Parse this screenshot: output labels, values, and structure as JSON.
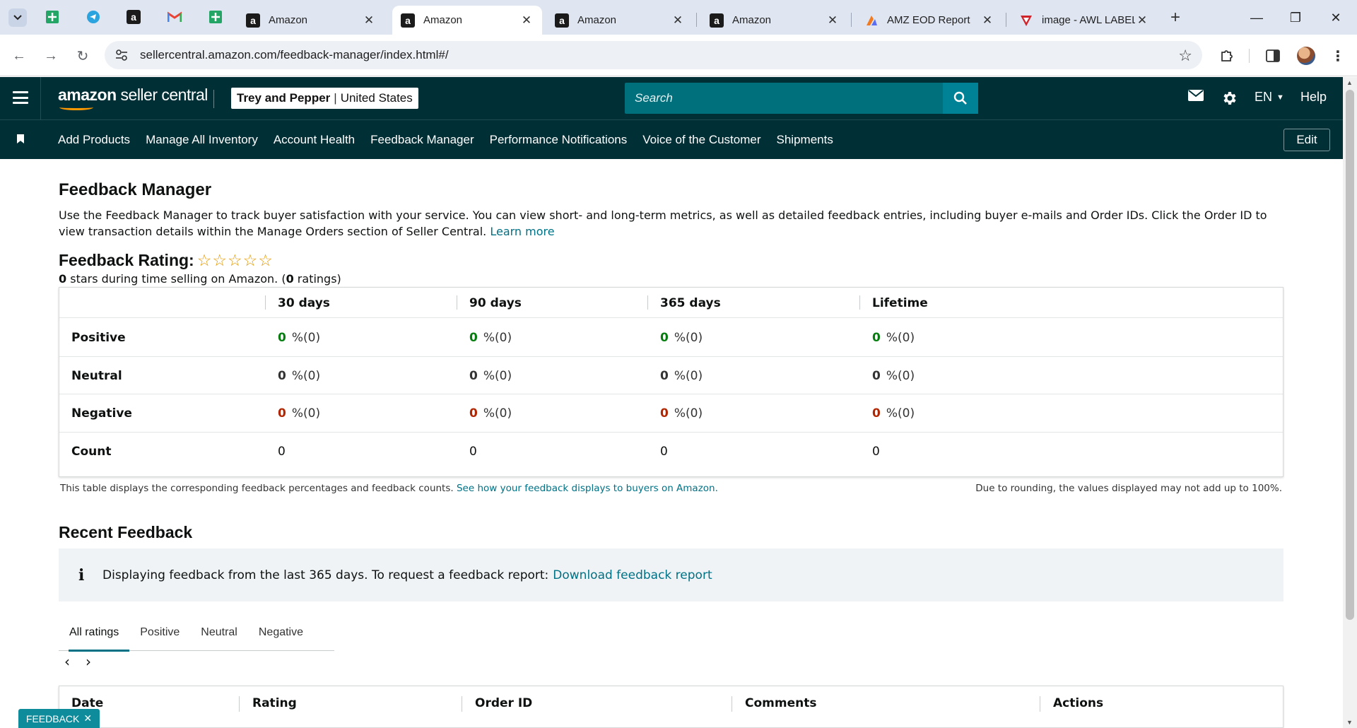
{
  "browser": {
    "tabs": [
      {
        "title": "Amazon",
        "active": false
      },
      {
        "title": "Amazon",
        "active": true
      },
      {
        "title": "Amazon",
        "active": false
      },
      {
        "title": "Amazon",
        "active": false
      },
      {
        "title": "AMZ EOD Report",
        "active": false
      },
      {
        "title": "image - AWL LABEL",
        "active": false
      }
    ],
    "url": "sellercentral.amazon.com/feedback-manager/index.html#/"
  },
  "header": {
    "logo_bold": "amazon",
    "logo_rest": " seller central",
    "store_name": "Trey and Pepper",
    "store_sep": "|",
    "store_region": "United States",
    "search_placeholder": "Search",
    "language": "EN",
    "help": "Help"
  },
  "nav": {
    "links": [
      "Add Products",
      "Manage All Inventory",
      "Account Health",
      "Feedback Manager",
      "Performance Notifications",
      "Voice of the Customer",
      "Shipments"
    ],
    "edit_label": "Edit"
  },
  "main": {
    "title": "Feedback Manager",
    "intro": "Use the Feedback Manager to track buyer satisfaction with your service. You can view short- and long-term metrics, as well as detailed feedback entries, including buyer e-mails and Order IDs. Click the Order ID to view transaction details within the Manage Orders section of Seller Central.",
    "learn_more": "Learn more",
    "rating_label": "Feedback Rating:",
    "stars_filled": 0,
    "stars_total": 5,
    "rating_stars_value": "0",
    "rating_sub_mid": " stars during time selling on Amazon. (",
    "rating_count": "0",
    "rating_sub_end": " ratings)"
  },
  "metrics": {
    "columns": [
      "30 days",
      "90 days",
      "365 days",
      "Lifetime"
    ],
    "rows": [
      {
        "label": "Positive",
        "type": "pos",
        "values": [
          [
            "0",
            "%(0)"
          ],
          [
            "0",
            "%(0)"
          ],
          [
            "0",
            "%(0)"
          ],
          [
            "0",
            "%(0)"
          ]
        ]
      },
      {
        "label": "Neutral",
        "type": "neu",
        "values": [
          [
            "0",
            "%(0)"
          ],
          [
            "0",
            "%(0)"
          ],
          [
            "0",
            "%(0)"
          ],
          [
            "0",
            "%(0)"
          ]
        ]
      },
      {
        "label": "Negative",
        "type": "neg",
        "values": [
          [
            "0",
            "%(0)"
          ],
          [
            "0",
            "%(0)"
          ],
          [
            "0",
            "%(0)"
          ],
          [
            "0",
            "%(0)"
          ]
        ]
      },
      {
        "label": "Count",
        "type": "count",
        "values": [
          [
            "0",
            ""
          ],
          [
            "0",
            ""
          ],
          [
            "0",
            ""
          ],
          [
            "0",
            ""
          ]
        ]
      }
    ],
    "note": "This table displays the corresponding feedback percentages and feedback counts.",
    "note_link": "See how your feedback displays to buyers on Amazon.",
    "rounding_note": "Due to rounding, the values displayed may not add up to 100%."
  },
  "recent": {
    "title": "Recent Feedback",
    "alert_text": "Displaying feedback from the last 365 days. To request a feedback report:",
    "alert_link": "Download feedback report",
    "tabs": [
      "All ratings",
      "Positive",
      "Neutral",
      "Negative"
    ],
    "selected_tab": "All ratings",
    "table_headers": [
      "Date",
      "Rating",
      "Order ID",
      "Comments",
      "Actions"
    ]
  },
  "feedback_button": "FEEDBACK"
}
